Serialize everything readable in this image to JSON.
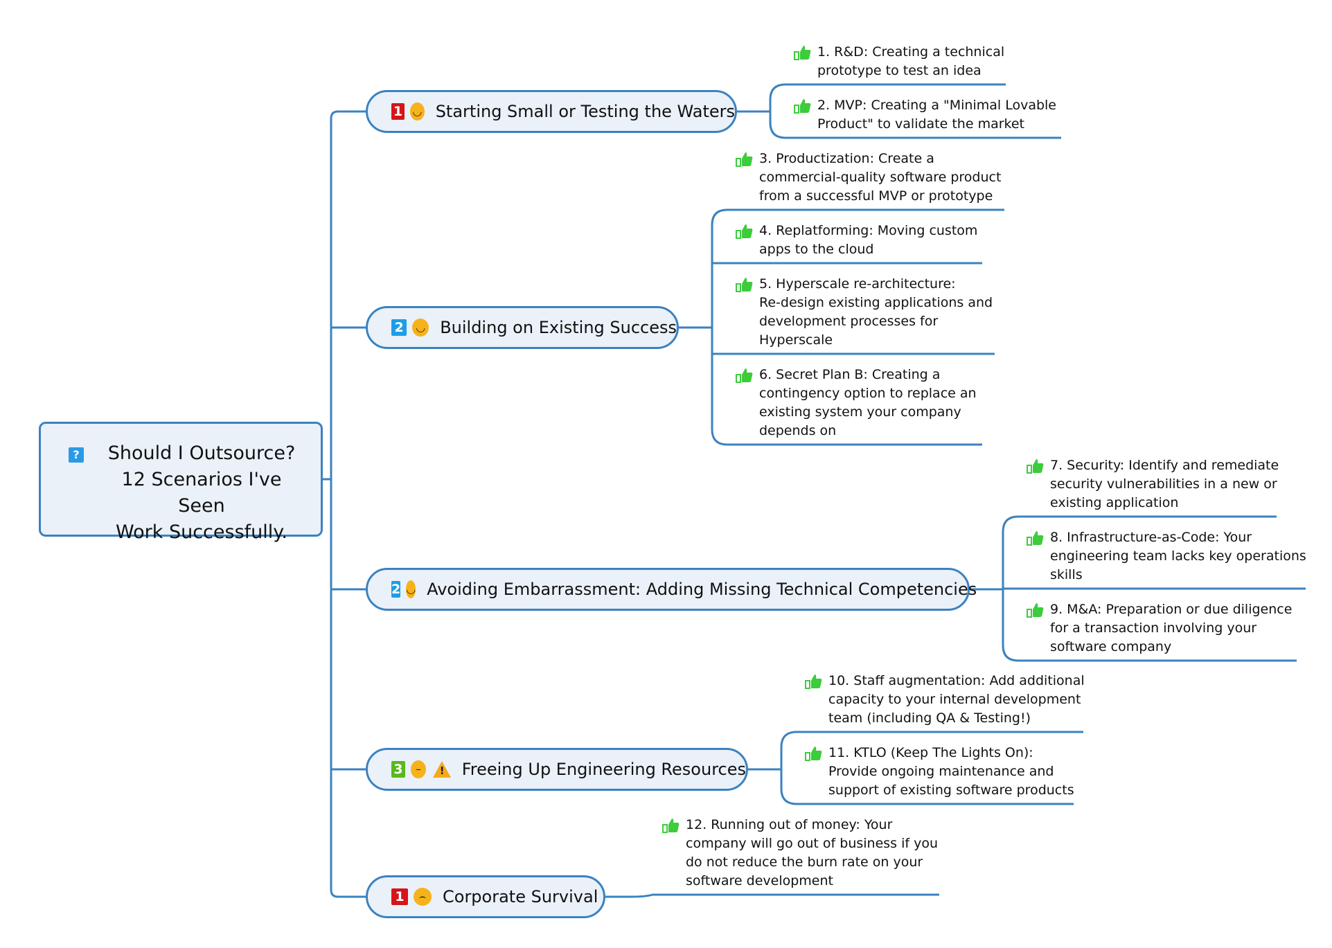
{
  "root": {
    "icon": "question-icon",
    "icon_glyph": "?",
    "lines": [
      "Should I Outsource?",
      "12 Scenarios I've Seen",
      "Work Successfully."
    ]
  },
  "colors": {
    "line": "#3b82c0",
    "node_fill": "#eaf1f9",
    "priority_1": "#d7141a",
    "priority_2": "#1e9de6",
    "priority_3": "#59b81c",
    "face": "#f6b21b",
    "thumb": "#3ccc3c"
  },
  "topics": [
    {
      "label": "Starting Small or Testing the Waters",
      "priority": "1",
      "mood": "smile",
      "warning": false,
      "leaves": [
        [
          "1. R&D: Creating a technical",
          "prototype to test an idea"
        ],
        [
          "2. MVP: Creating a \"Minimal Lovable",
          "Product\" to validate the market"
        ]
      ]
    },
    {
      "label": "Building on Existing Success",
      "priority": "2",
      "mood": "smile",
      "warning": false,
      "leaves": [
        [
          "3. Productization: Create a",
          "commercial-quality software product",
          "from a successful MVP or prototype"
        ],
        [
          "4. Replatforming: Moving custom",
          "apps to the cloud"
        ],
        [
          "5. Hyperscale re-architecture:",
          "Re-design existing applications and",
          "development processes for",
          "Hyperscale"
        ],
        [
          "6. Secret Plan B: Creating a",
          "contingency option to replace an",
          "existing system your company",
          "depends on"
        ]
      ]
    },
    {
      "label": "Avoiding Embarrassment: Adding Missing Technical Competencies",
      "priority": "2",
      "mood": "smile",
      "warning": false,
      "leaves": [
        [
          "7. Security: Identify and remediate",
          "security vulnerabilities in a new or",
          "existing application"
        ],
        [
          "8. Infrastructure-as-Code: Your",
          "engineering team lacks key operations",
          "skills"
        ],
        [
          "9. M&A: Preparation or due diligence",
          "for a transaction involving your",
          "software company"
        ]
      ]
    },
    {
      "label": "Freeing Up Engineering Resources",
      "priority": "3",
      "mood": "neutral",
      "warning": true,
      "leaves": [
        [
          "10. Staff augmentation: Add additional",
          "capacity to your internal development",
          "team (including QA & Testing!)"
        ],
        [
          "11. KTLO (Keep The Lights On):",
          "Provide ongoing maintenance and",
          "support of existing software products"
        ]
      ]
    },
    {
      "label": "Corporate Survival",
      "priority": "1",
      "mood": "sad",
      "warning": false,
      "leaves": [
        [
          "12. Running out of money: Your",
          "company will go out of business if you",
          "do not reduce the burn rate on your",
          "software development"
        ]
      ]
    }
  ]
}
